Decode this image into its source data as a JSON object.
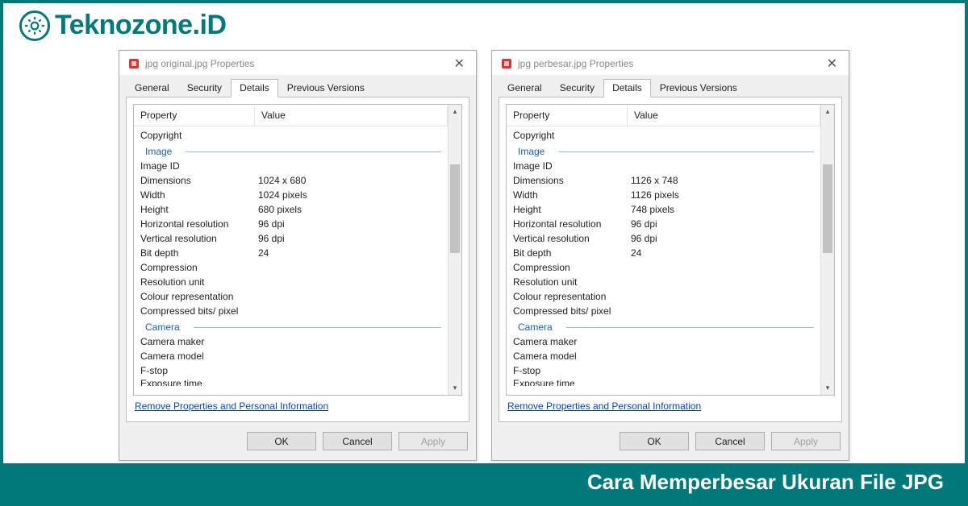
{
  "brand": {
    "name": "Teknozone.iD"
  },
  "caption": "Cara Memperbesar Ukuran File JPG",
  "common": {
    "tabs": [
      "General",
      "Security",
      "Details",
      "Previous Versions"
    ],
    "active_tab": "Details",
    "header_property": "Property",
    "header_value": "Value",
    "section_image": "Image",
    "section_camera": "Camera",
    "remove_link": "Remove Properties and Personal Information",
    "buttons": {
      "ok": "OK",
      "cancel": "Cancel",
      "apply": "Apply"
    }
  },
  "dialogs": [
    {
      "title": "jpg original.jpg Properties",
      "rows_pre": [
        {
          "k": "Copyright",
          "v": ""
        }
      ],
      "image_rows": [
        {
          "k": "Image ID",
          "v": ""
        },
        {
          "k": "Dimensions",
          "v": "1024 x 680"
        },
        {
          "k": "Width",
          "v": "1024 pixels"
        },
        {
          "k": "Height",
          "v": "680 pixels"
        },
        {
          "k": "Horizontal resolution",
          "v": "96 dpi"
        },
        {
          "k": "Vertical resolution",
          "v": "96 dpi"
        },
        {
          "k": "Bit depth",
          "v": "24"
        },
        {
          "k": "Compression",
          "v": ""
        },
        {
          "k": "Resolution unit",
          "v": ""
        },
        {
          "k": "Colour representation",
          "v": ""
        },
        {
          "k": "Compressed bits/ pixel",
          "v": ""
        }
      ],
      "camera_rows": [
        {
          "k": "Camera maker",
          "v": ""
        },
        {
          "k": "Camera model",
          "v": ""
        },
        {
          "k": "F-stop",
          "v": ""
        }
      ],
      "truncated_row": "Exposure time"
    },
    {
      "title": "jpg perbesar.jpg Properties",
      "rows_pre": [
        {
          "k": "Copyright",
          "v": ""
        }
      ],
      "image_rows": [
        {
          "k": "Image ID",
          "v": ""
        },
        {
          "k": "Dimensions",
          "v": "1126 x 748"
        },
        {
          "k": "Width",
          "v": "1126 pixels"
        },
        {
          "k": "Height",
          "v": "748 pixels"
        },
        {
          "k": "Horizontal resolution",
          "v": "96 dpi"
        },
        {
          "k": "Vertical resolution",
          "v": "96 dpi"
        },
        {
          "k": "Bit depth",
          "v": "24"
        },
        {
          "k": "Compression",
          "v": ""
        },
        {
          "k": "Resolution unit",
          "v": ""
        },
        {
          "k": "Colour representation",
          "v": ""
        },
        {
          "k": "Compressed bits/ pixel",
          "v": ""
        }
      ],
      "camera_rows": [
        {
          "k": "Camera maker",
          "v": ""
        },
        {
          "k": "Camera model",
          "v": ""
        },
        {
          "k": "F-stop",
          "v": ""
        }
      ],
      "truncated_row": "Exposure time"
    }
  ]
}
